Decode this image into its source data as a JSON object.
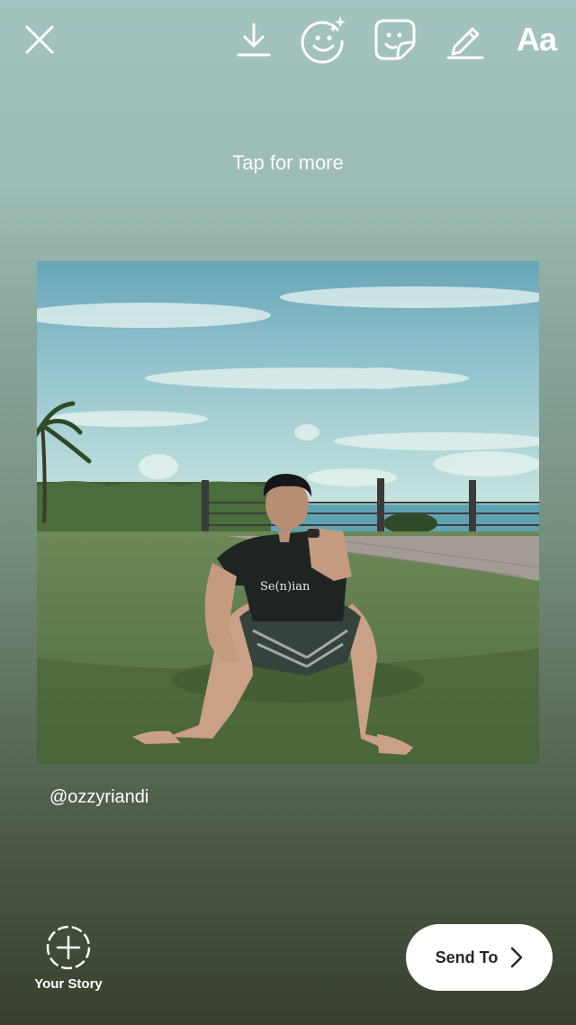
{
  "top_bar": {
    "icons": [
      "close-icon",
      "download-icon",
      "face-sparkle-icon",
      "sticker-icon",
      "draw-icon",
      "text-icon"
    ],
    "text_tool_label": "Aa"
  },
  "hint": {
    "text": "Tap for more"
  },
  "post": {
    "username": "@ozzyriandi",
    "image_description": "man sitting on grass by the sea",
    "shirt_text": "Se(n)ian"
  },
  "bottom_bar": {
    "your_story_label": "Your Story",
    "send_to_label": "Send To"
  },
  "colors": {
    "background_top": "#a2c3bf",
    "background_bottom": "#38402f",
    "send_button_bg": "#ffffff",
    "send_button_text": "#262626"
  }
}
